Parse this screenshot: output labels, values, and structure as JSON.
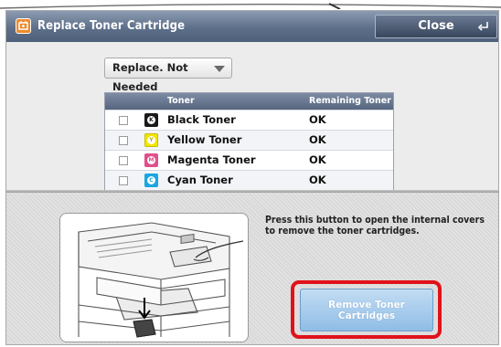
{
  "window": {
    "title": "Replace Toner Cartridge",
    "close_label": "Close"
  },
  "filter": {
    "selected": "Replace. Not Needed"
  },
  "table": {
    "headers": [
      "Toner",
      "Remaining Toner"
    ],
    "rows": [
      {
        "name": "Black Toner",
        "status": "OK",
        "icon_letter": "K",
        "icon": "black-toner-icon",
        "color": "#1a1a1a"
      },
      {
        "name": "Yellow Toner",
        "status": "OK",
        "icon_letter": "Y",
        "icon": "yellow-toner-icon",
        "color": "#f2e600"
      },
      {
        "name": "Magenta Toner",
        "status": "OK",
        "icon_letter": "M",
        "icon": "magenta-toner-icon",
        "color": "#e0508a"
      },
      {
        "name": "Cyan Toner",
        "status": "OK",
        "icon_letter": "C",
        "icon": "cyan-toner-icon",
        "color": "#1aa6e0"
      }
    ]
  },
  "instruction": "Press this button to open the internal covers to remove the toner cartridges.",
  "remove_button": {
    "label_line1": "Remove Toner",
    "label_line2": "Cartridges"
  },
  "colors": {
    "titlebar": "#5d6f89",
    "highlight": "#e0121a",
    "button": "#a9cdee"
  }
}
